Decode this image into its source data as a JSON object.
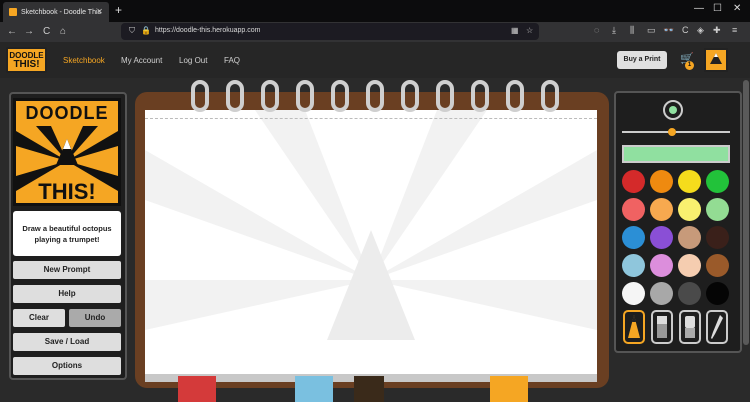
{
  "browser": {
    "tab_title": "Sketchbook - Doodle This",
    "tab_close": "✕",
    "new_tab": "+",
    "url": "https://doodle-this.herokuapp.com",
    "nav": {
      "back": "←",
      "forward": "→",
      "reload": "C",
      "home": "⌂"
    }
  },
  "site": {
    "logo_line1": "DOODLE",
    "logo_line2": "THIS!",
    "nav_items": [
      "Sketchbook",
      "My Account",
      "Log Out",
      "FAQ"
    ],
    "buy_print": "Buy a Print",
    "cart_count": "1"
  },
  "left_panel": {
    "logo_top": "DOODLE",
    "logo_bottom": "THIS!",
    "prompt": "Draw a beautiful octopus playing a trumpet!",
    "buttons": {
      "new_prompt": "New Prompt",
      "help": "Help",
      "clear": "Clear",
      "undo": "Undo",
      "save_load": "Save / Load",
      "options": "Options"
    }
  },
  "right_panel": {
    "current_color": "#90e0a0",
    "palette": [
      "#d42a2a",
      "#ef8a10",
      "#f5dc1c",
      "#22c23a",
      "#f06262",
      "#f7a94f",
      "#f9f06f",
      "#93dc93",
      "#2b8fd6",
      "#8a4fd6",
      "#c79a7a",
      "#3a201a",
      "#8fc6dc",
      "#dc8edc",
      "#f5cdb0",
      "#9a5a2a",
      "#f5f5f5",
      "#a8a8a8",
      "#4a4a4a",
      "#050505"
    ],
    "tools": [
      "pencil-icon",
      "marker-icon",
      "eraser-icon",
      "eyedropper-icon"
    ]
  },
  "colors": {
    "accent": "#f5a623",
    "sketchbook_cover": "#6a3f22"
  }
}
